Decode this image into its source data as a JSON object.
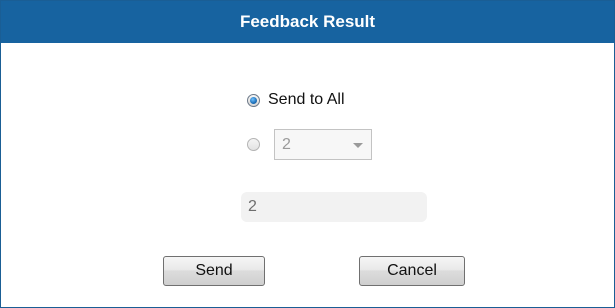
{
  "dialog": {
    "title": "Feedback Result"
  },
  "recipients": {
    "send_to_all_label": "Send to All",
    "send_to_all_selected": true,
    "specific_selected": false,
    "specific_value": "2"
  },
  "info_field": {
    "value": "2"
  },
  "buttons": {
    "send_label": "Send",
    "cancel_label": "Cancel"
  },
  "colors": {
    "titlebar": "#1763a0",
    "title_text": "#ffffff",
    "radio_checked": "#1d6fb8"
  }
}
